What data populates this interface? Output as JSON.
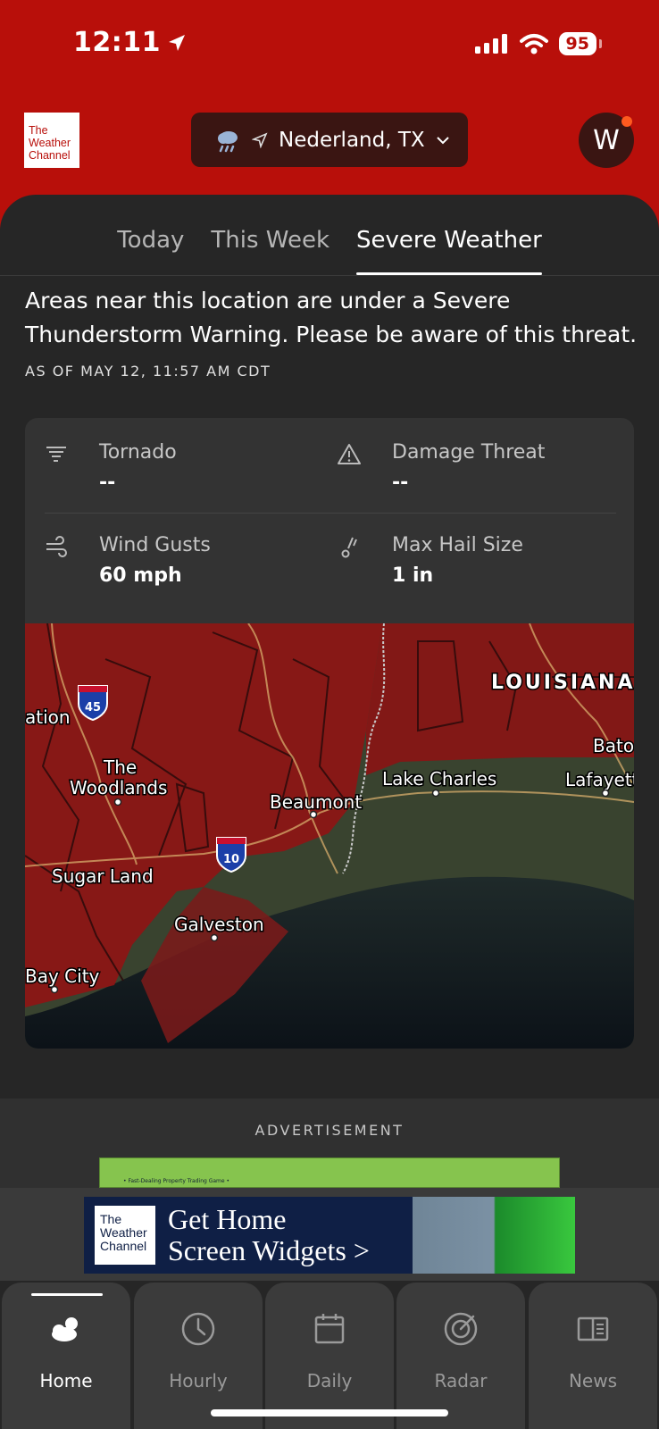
{
  "status_bar": {
    "time": "12:11",
    "battery": "95"
  },
  "header": {
    "logo_lines": [
      "The",
      "Weather",
      "Channel"
    ],
    "location": "Nederland, TX",
    "avatar_letter": "W"
  },
  "tabs": [
    {
      "label": "Today",
      "active": false
    },
    {
      "label": "This Week",
      "active": false
    },
    {
      "label": "Severe Weather",
      "active": true
    }
  ],
  "alert": {
    "message": "Areas near this location are under a Severe Thunderstorm Warning. Please be aware of this threat.",
    "as_of": "AS OF MAY 12, 11:57 AM CDT"
  },
  "stats": [
    {
      "label": "Tornado",
      "value": "--",
      "icon": "tornado-icon"
    },
    {
      "label": "Damage Threat",
      "value": "--",
      "icon": "warning-triangle-icon"
    },
    {
      "label": "Wind Gusts",
      "value": "60 mph",
      "icon": "wind-icon"
    },
    {
      "label": "Max Hail Size",
      "value": "1 in",
      "icon": "hail-icon"
    }
  ],
  "map": {
    "labels": {
      "louisiana": "LOUISIANA",
      "ation": "ation",
      "the": "The",
      "woodlands": "Woodlands",
      "lake_charles": "Lake Charles",
      "baton": "Bato",
      "lafayette": "Lafayett",
      "beaumont": "Beaumont",
      "sugar_land": "Sugar Land",
      "galveston": "Galveston",
      "bay_city": "Bay City",
      "i45": "45",
      "i10": "10"
    }
  },
  "ad": {
    "label": "ADVERTISEMENT",
    "peek_text": "• Fast-Dealing Property Trading Game •"
  },
  "banner": {
    "logo_lines": [
      "The",
      "Weather",
      "Channel"
    ],
    "line1": "Get Home",
    "line2": "Screen Widgets >"
  },
  "bottom_nav": [
    {
      "label": "Home",
      "icon": "home-weather-icon",
      "active": true
    },
    {
      "label": "Hourly",
      "icon": "clock-icon",
      "active": false
    },
    {
      "label": "Daily",
      "icon": "calendar-icon",
      "active": false
    },
    {
      "label": "Radar",
      "icon": "radar-icon",
      "active": false
    },
    {
      "label": "News",
      "icon": "news-icon",
      "active": false
    }
  ],
  "colors": {
    "brand_red": "#b80f0a",
    "background": "#262626",
    "card": "#333333",
    "alert_zone": "#9b1313"
  }
}
